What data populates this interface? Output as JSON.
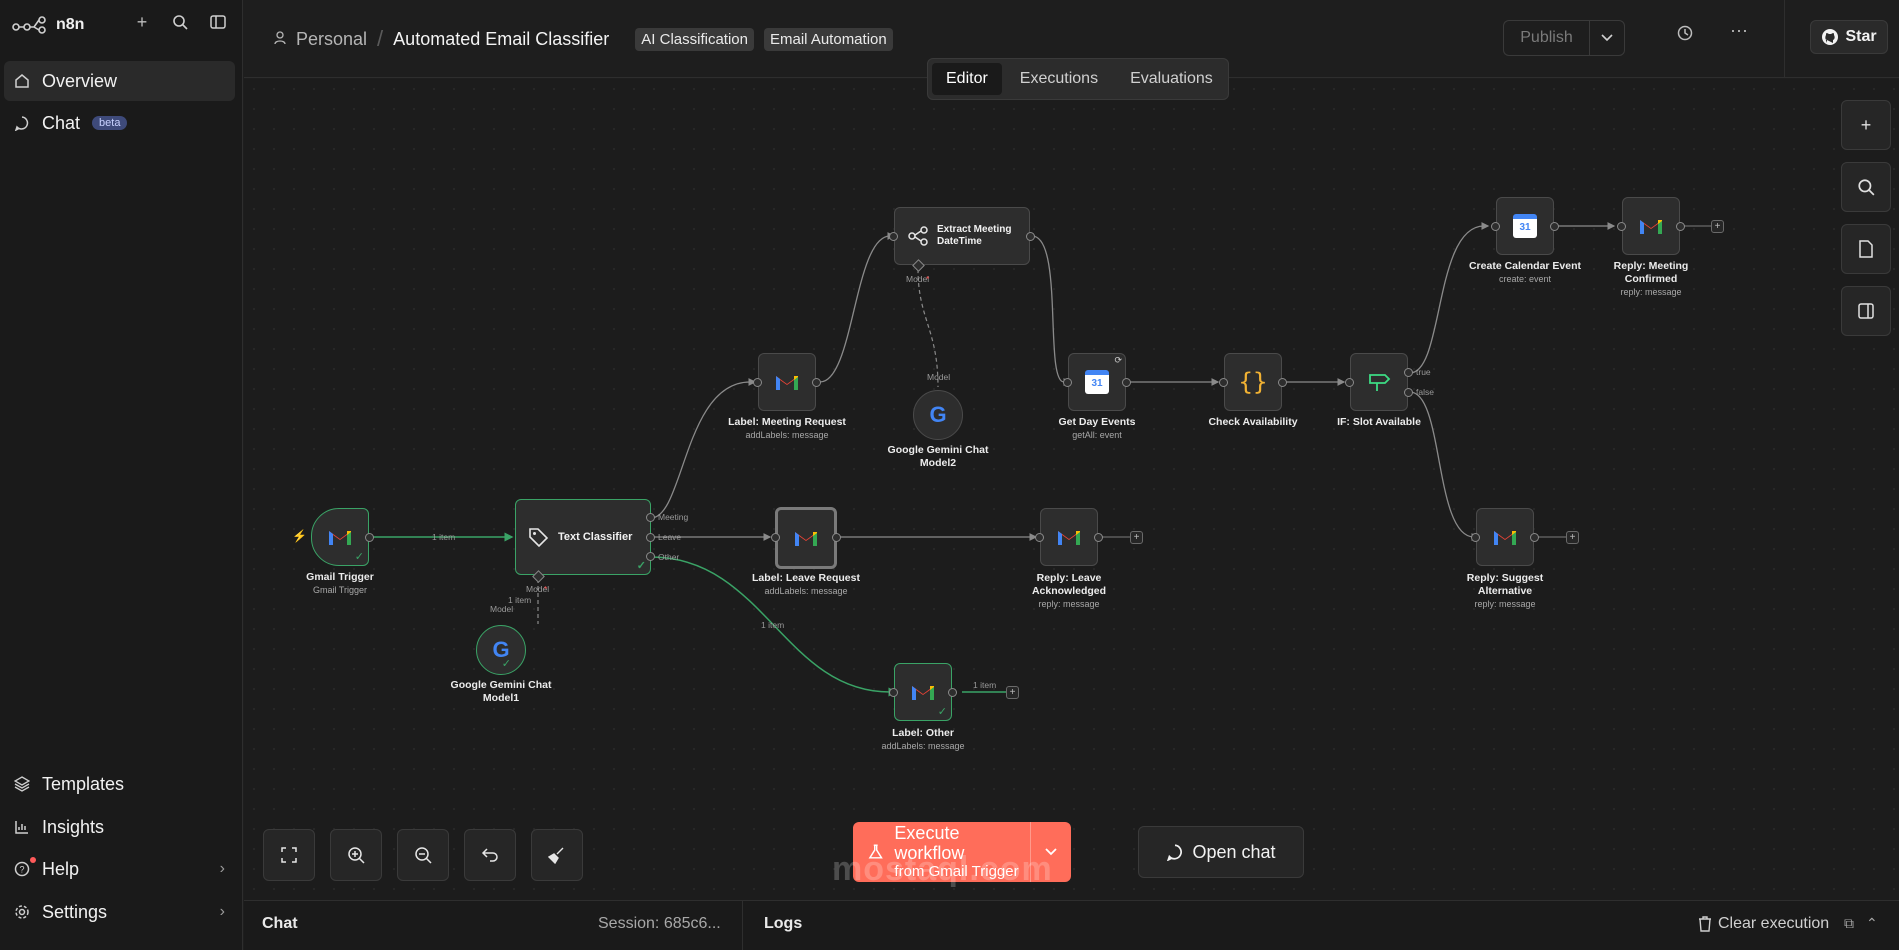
{
  "app": {
    "logo_text": "n8n"
  },
  "sidebar": {
    "items": [
      {
        "label": "Overview",
        "icon": "home-icon"
      },
      {
        "label": "Chat",
        "badge": "beta",
        "icon": "chat-icon"
      }
    ],
    "bottom_items": [
      {
        "label": "Templates",
        "icon": "templates-icon"
      },
      {
        "label": "Insights",
        "icon": "insights-icon"
      },
      {
        "label": "Help",
        "icon": "help-icon"
      },
      {
        "label": "Settings",
        "icon": "settings-icon"
      }
    ]
  },
  "header": {
    "project": "Personal",
    "workflow_name": "Automated Email Classifier",
    "tags": [
      "AI Classification",
      "Email Automation"
    ],
    "publish_label": "Publish",
    "star_label": "Star"
  },
  "tabs": [
    "Editor",
    "Executions",
    "Evaluations"
  ],
  "nodes": {
    "gmail_trigger": {
      "label": "Gmail Trigger",
      "sub": "Gmail Trigger"
    },
    "text_classifier": {
      "label": "Text Classifier"
    },
    "gemini1": {
      "label1": "Google Gemini Chat",
      "label2": "Model1"
    },
    "gemini2": {
      "label1": "Google Gemini Chat",
      "label2": "Model2"
    },
    "label_meeting": {
      "label": "Label: Meeting Request",
      "sub": "addLabels: message"
    },
    "label_leave": {
      "label": "Label: Leave Request",
      "sub": "addLabels: message"
    },
    "label_other": {
      "label": "Label: Other",
      "sub": "addLabels: message"
    },
    "extract_meeting": {
      "label1": "Extract Meeting",
      "label2": "DateTime"
    },
    "get_day_events": {
      "label": "Get Day Events",
      "sub": "getAll: event",
      "cal_day": "31"
    },
    "check_availability": {
      "label": "Check Availability"
    },
    "if_slot": {
      "label": "IF: Slot Available"
    },
    "create_event": {
      "label": "Create Calendar Event",
      "sub": "create: event",
      "cal_day": "31"
    },
    "reply_confirmed": {
      "label1": "Reply: Meeting",
      "label2": "Confirmed",
      "sub": "reply: message"
    },
    "reply_leave": {
      "label1": "Reply: Leave",
      "label2": "Acknowledged",
      "sub": "reply: message"
    },
    "reply_alternative": {
      "label1": "Reply: Suggest",
      "label2": "Alternative",
      "sub": "reply: message"
    }
  },
  "wire_labels": {
    "one_item": "1 item",
    "meeting": "Meeting",
    "leave": "Leave",
    "other": "Other",
    "model": "Model",
    "model_req": "Model",
    "true": "true",
    "false": "false"
  },
  "actions": {
    "execute_l1": "Execute workflow",
    "execute_l2": "from Gmail Trigger",
    "open_chat": "Open chat"
  },
  "bottom": {
    "chat": "Chat",
    "session": "Session: 685c6...",
    "logs": "Logs",
    "clear": "Clear execution"
  },
  "watermark": "mostaql.com",
  "colors": {
    "accent": "#ff6d5a",
    "success": "#3aa366",
    "background": "#1e1e1e"
  }
}
